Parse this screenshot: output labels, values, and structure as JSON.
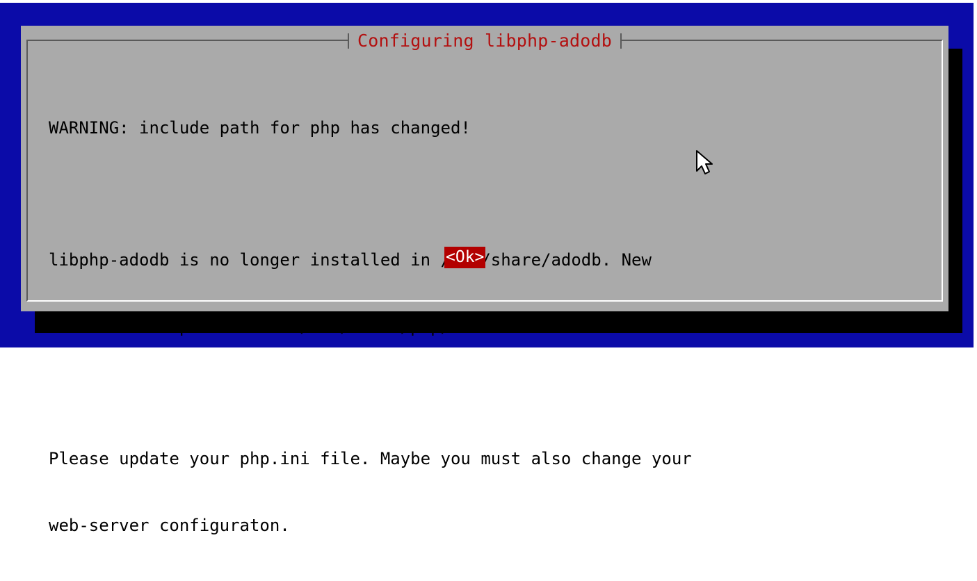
{
  "dialog": {
    "title": "Configuring libphp-adodb",
    "message": {
      "line1": "WARNING: include path for php has changed!",
      "line2": "libphp-adodb is no longer installed in /usr/share/adodb. New",
      "line3": "installation path is now /usr/share/php/adodb.",
      "line4": "Please update your php.ini file. Maybe you must also change your",
      "line5": "web-server configuraton."
    },
    "ok_button": "<Ok>"
  },
  "colors": {
    "background": "#0b0ba8",
    "dialog": "#aaaaaa",
    "title": "#b31010",
    "button": "#b30000"
  },
  "icons": {
    "cursor": "mouse-pointer-icon"
  }
}
